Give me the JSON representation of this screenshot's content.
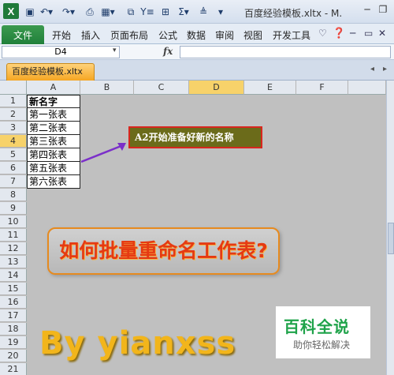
{
  "window": {
    "title": "百度经验模板.xltx - M.",
    "quick_access": [
      "save",
      "undo",
      "redo",
      "print-preview",
      "borders",
      "filter",
      "form",
      "grid",
      "sum",
      "sort",
      "customize"
    ]
  },
  "ribbon": {
    "file_label": "文件",
    "tabs": [
      "开始",
      "插入",
      "页面布局",
      "公式",
      "数据",
      "审阅",
      "视图",
      "开发工具"
    ]
  },
  "formula_bar": {
    "name_box": "D4",
    "fx_label": "fx",
    "content": ""
  },
  "workbook_tab": "百度经验模板.xltx",
  "columns": [
    "A",
    "B",
    "C",
    "D",
    "E",
    "F"
  ],
  "selected_column": "D",
  "rows": [
    "1",
    "2",
    "3",
    "4",
    "5",
    "6",
    "7",
    "8",
    "9",
    "10",
    "11",
    "12",
    "13",
    "14",
    "15",
    "16",
    "17",
    "18",
    "19",
    "20",
    "21"
  ],
  "selected_row": "4",
  "cells": {
    "A1": "新名字",
    "A2": "第一张表",
    "A3": "第二张表",
    "A4": "第三张表",
    "A5": "第四张表",
    "A6": "第五张表",
    "A7": "第六张表"
  },
  "annotation": "A2开始准备好新的名称",
  "banner": "如何批量重命名工作表?",
  "byline": "By  yianxss",
  "logo": {
    "title": "百科全说",
    "subtitle": "助你轻松解决"
  },
  "colors": {
    "accent_green": "#1f7a3a",
    "tab_orange": "#f5a623",
    "banner_text": "#e53a12",
    "byline": "#f2b51b",
    "logo_green": "#1fa34a",
    "annotation_border": "#d8261e"
  }
}
